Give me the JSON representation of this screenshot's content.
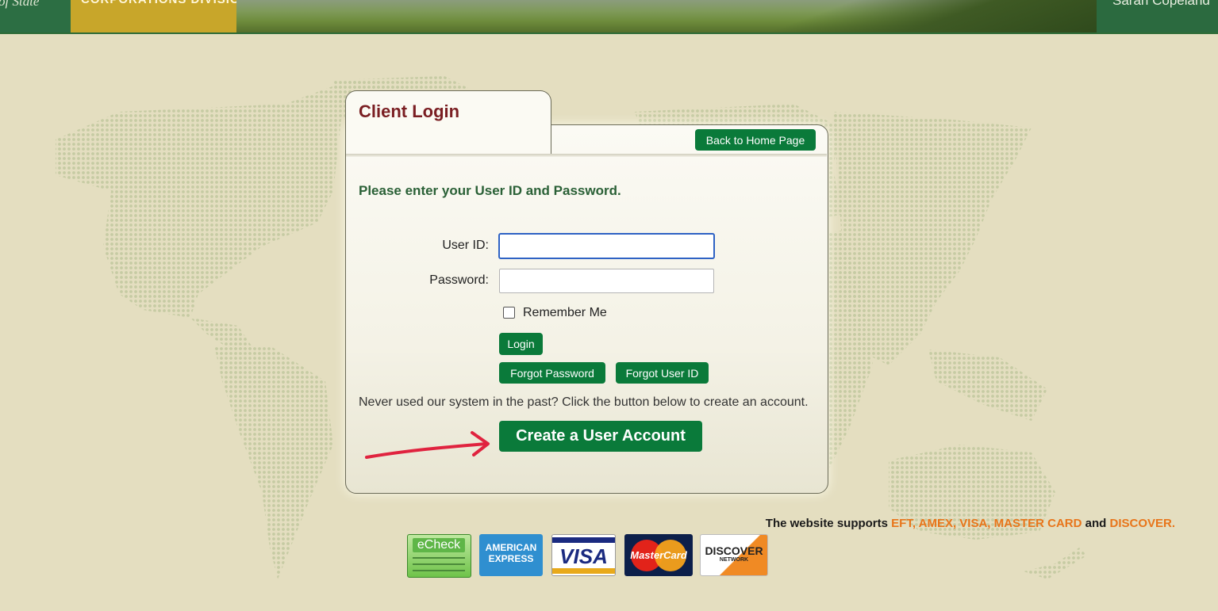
{
  "header": {
    "left_text": "of State",
    "division": "CORPORATIONS DIVISION",
    "right_text": "Sarah Copeland"
  },
  "panel": {
    "title": "Client Login",
    "back_button": "Back to Home Page",
    "instructions": "Please enter your User ID and Password.",
    "userid_label": "User ID:",
    "userid_value": "",
    "password_label": "Password:",
    "password_value": "",
    "remember_label": "Remember Me",
    "remember_checked": false,
    "login_button": "Login",
    "forgot_password_button": "Forgot Password",
    "forgot_userid_button": "Forgot User ID",
    "never_text": "Never used our system in the past? Click the button below to create an account.",
    "create_button": "Create a User Account"
  },
  "payments": {
    "prefix": "The website supports",
    "methods": "EFT, AMEX, VISA, MASTER CARD",
    "and": "and",
    "last": "DISCOVER.",
    "cards": [
      {
        "name": "echeck",
        "label": "eCheck"
      },
      {
        "name": "amex",
        "label": "AMERICAN EXPRESS"
      },
      {
        "name": "visa",
        "label": "VISA"
      },
      {
        "name": "mastercard",
        "label": "MasterCard"
      },
      {
        "name": "discover",
        "label": "DISCOVER",
        "sub": "NETWORK"
      }
    ]
  },
  "colors": {
    "brand_green": "#0a7a3a",
    "title_red": "#7a1e22",
    "highlight_orange": "#e8751a",
    "background": "#e4dec0"
  }
}
